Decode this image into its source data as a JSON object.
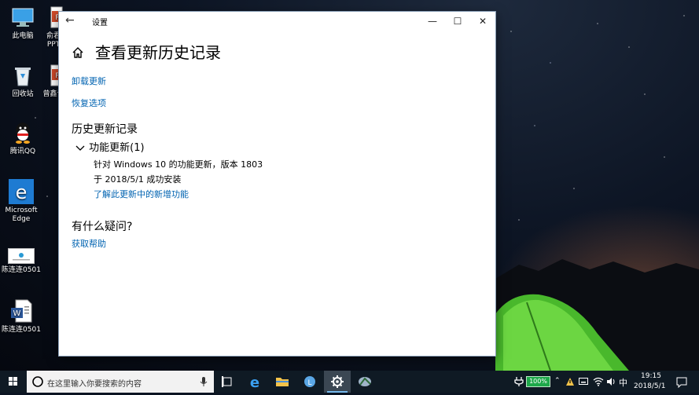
{
  "desktop": {
    "icons": [
      {
        "label": "此电脑",
        "icon": "computer-icon"
      },
      {
        "label": "回收站",
        "icon": "recycle-bin-icon"
      },
      {
        "label": "腾讯QQ",
        "icon": "qq-icon"
      },
      {
        "label": "Microsoft Edge",
        "icon": "edge-icon"
      },
      {
        "label": "陈连连0501",
        "icon": "image-file-icon"
      },
      {
        "label": "陈连连0501",
        "icon": "word-doc-icon"
      },
      {
        "label": "俞君\nPPT",
        "icon": "ppt-icon"
      },
      {
        "label": "曾鑫设",
        "icon": "ppt-icon"
      }
    ]
  },
  "window": {
    "title": "设置",
    "controls": {
      "minimize": "—",
      "maximize": "☐",
      "close": "✕"
    },
    "page_title": "查看更新历史记录",
    "links": {
      "uninstall": "卸载更新",
      "recovery": "恢复选项"
    },
    "history": {
      "heading": "历史更新记录",
      "category": "功能更新(1)",
      "update_name": "针对 Windows 10 的功能更新，版本 1803",
      "update_status": "于 2018/5/1 成功安装",
      "learn_more": "了解此更新中的新增功能"
    },
    "help": {
      "heading": "有什么疑问?",
      "link": "获取帮助"
    }
  },
  "taskbar": {
    "search_placeholder": "在这里输入你要搜索的内容",
    "battery": "100%",
    "ime": "中",
    "time": "19:15",
    "date": "2018/5/1"
  },
  "colors": {
    "accent": "#0063b1",
    "taskbar": "#0f1a24",
    "tent": "#5cd23a"
  }
}
